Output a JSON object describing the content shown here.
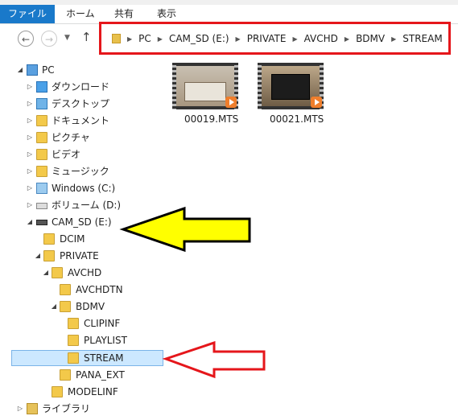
{
  "ribbon": {
    "tabs": [
      "ファイル",
      "ホーム",
      "共有",
      "表示"
    ]
  },
  "nav": {
    "back_icon": "back-arrow-icon",
    "forward_icon": "forward-arrow-icon",
    "recent_icon": "chevron-down-icon",
    "up_icon": "up-arrow-icon"
  },
  "address": {
    "crumbs": [
      "PC",
      "CAM_SD (E:)",
      "PRIVATE",
      "AVCHD",
      "BDMV",
      "STREAM"
    ]
  },
  "tree": {
    "items": [
      {
        "label": "PC",
        "expanded": true,
        "icon": "pc-icon"
      },
      {
        "label": "ダウンロード",
        "icon": "downloads-icon"
      },
      {
        "label": "デスクトップ",
        "icon": "desktop-icon"
      },
      {
        "label": "ドキュメント",
        "icon": "documents-icon"
      },
      {
        "label": "ピクチャ",
        "icon": "pictures-icon"
      },
      {
        "label": "ビデオ",
        "icon": "videos-icon"
      },
      {
        "label": "ミュージック",
        "icon": "music-icon"
      },
      {
        "label": "Windows (C:)",
        "icon": "drive-icon"
      },
      {
        "label": "ボリューム (D:)",
        "icon": "drive-icon"
      },
      {
        "label": "CAM_SD (E:)",
        "expanded": true,
        "icon": "removable-drive-icon"
      },
      {
        "label": "DCIM",
        "icon": "folder-icon"
      },
      {
        "label": "PRIVATE",
        "expanded": true,
        "icon": "folder-icon"
      },
      {
        "label": "AVCHD",
        "expanded": true,
        "icon": "folder-icon"
      },
      {
        "label": "AVCHDTN",
        "icon": "folder-icon"
      },
      {
        "label": "BDMV",
        "expanded": true,
        "icon": "folder-icon"
      },
      {
        "label": "CLIPINF",
        "icon": "folder-icon"
      },
      {
        "label": "PLAYLIST",
        "icon": "folder-icon"
      },
      {
        "label": "STREAM",
        "selected": true,
        "icon": "folder-icon"
      },
      {
        "label": "PANA_EXT",
        "icon": "folder-icon"
      },
      {
        "label": "MODELINF",
        "icon": "folder-icon"
      },
      {
        "label": "ライブラリ",
        "icon": "libraries-icon"
      }
    ]
  },
  "files": [
    {
      "name": "00019.MTS",
      "icon": "video-file-icon"
    },
    {
      "name": "00021.MTS",
      "icon": "video-file-icon"
    }
  ],
  "annotations": {
    "red_box_color": "#e5161b",
    "yellow_arrow_color": "#ffff00",
    "red_arrow_color": "#e5161b"
  }
}
